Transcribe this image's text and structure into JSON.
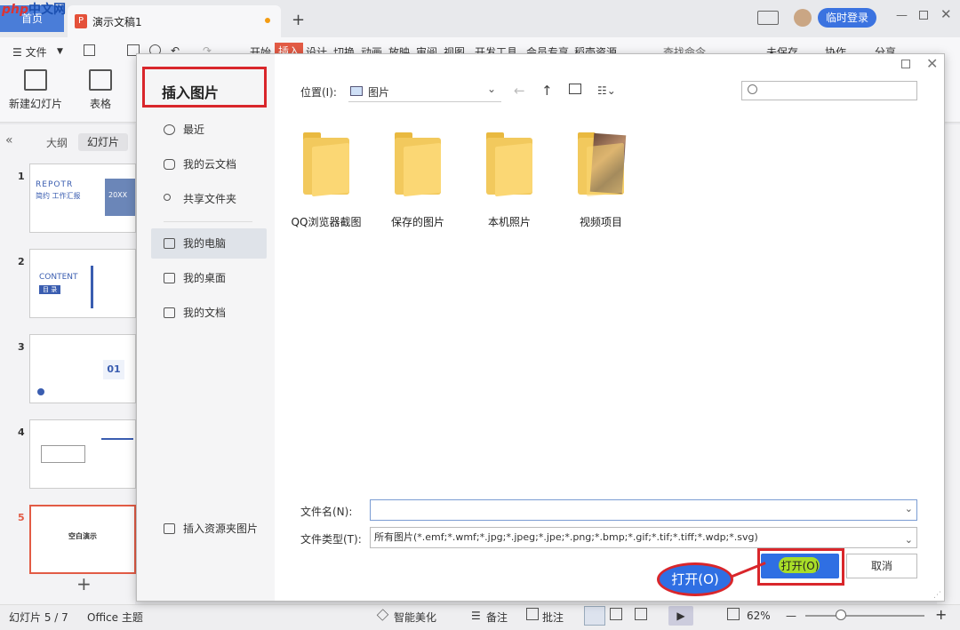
{
  "titlebar": {
    "home": "首页",
    "watermark_a": "php",
    "watermark_b": "中文网",
    "doc_icon": "P",
    "doc_title": "演示文稿1",
    "new_tab": "+",
    "login": "临时登录"
  },
  "menu": {
    "hamburger": "☰ 文件",
    "items": [
      "开始",
      "插入",
      "设计",
      "切换",
      "动画",
      "放映",
      "审阅",
      "视图",
      "开发工具",
      "会员专享",
      "稻壳资源"
    ],
    "search": "查找命令...",
    "save_status": "未保存",
    "collab": "协作",
    "share": "分享"
  },
  "ribbon": {
    "new_slide": "新建幻灯片",
    "table": "表格"
  },
  "leftpanel": {
    "tab_outline": "大纲",
    "tab_slides": "幻灯片",
    "slide_numbers": [
      "1",
      "2",
      "3",
      "4",
      "5"
    ],
    "slide1_title": "REPOTR",
    "slide1_sub": "简约 工作汇报",
    "slide1_year": "20XX",
    "slide2_title": "CONTENT",
    "slide2_sub": "目 录",
    "slide3_num": "01",
    "slide5_title": "空白演示",
    "add": "+"
  },
  "dialog": {
    "title": "插入图片",
    "nav": [
      {
        "label": "最近"
      },
      {
        "label": "我的云文档"
      },
      {
        "label": "共享文件夹"
      },
      {
        "label": "我的电脑"
      },
      {
        "label": "我的桌面"
      },
      {
        "label": "我的文档"
      }
    ],
    "resource_folder": "插入资源夹图片",
    "location_label": "位置(I):",
    "location_value": "图片",
    "search_placeholder": "",
    "folders": [
      "QQ浏览器截图",
      "保存的图片",
      "本机照片",
      "视频项目"
    ],
    "filename_label": "文件名(N):",
    "filename_value": "",
    "filetype_label": "文件类型(T):",
    "filetype_value": "所有图片(*.emf;*.wmf;*.jpg;*.jpeg;*.jpe;*.png;*.bmp;*.gif;*.tif;*.tiff;*.wdp;*.svg)",
    "open": "打开(O)",
    "cancel": "取消",
    "callout": "打开(O)"
  },
  "status": {
    "slide_pos": "幻灯片 5 / 7",
    "theme": "Office 主题",
    "beautify": "智能美化",
    "notes": "备注",
    "comments": "批注",
    "zoom": "62%"
  },
  "colors": {
    "accent": "#2f6fe3",
    "highlight_red": "#d9262b",
    "insert_tab": "#e25b45"
  }
}
